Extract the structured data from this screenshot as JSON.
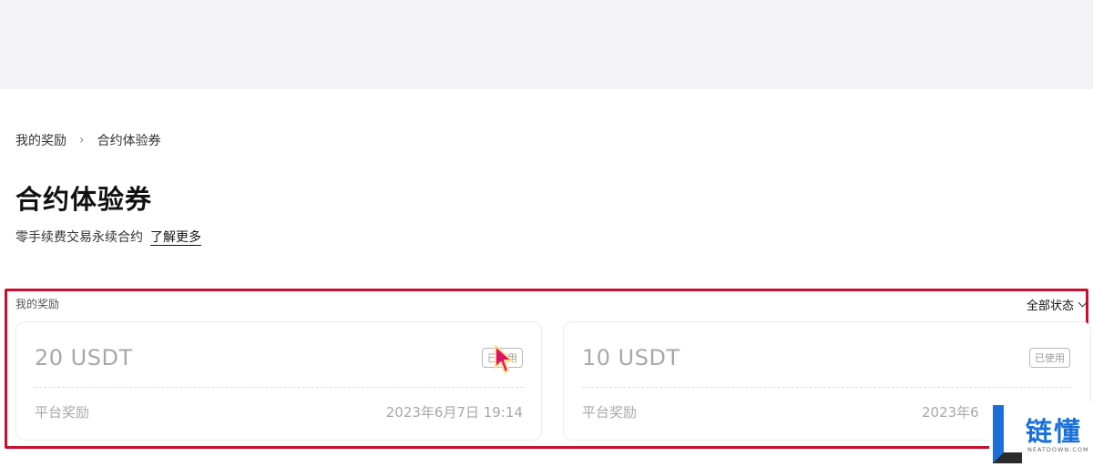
{
  "breadcrumb": {
    "parent": "我的奖励",
    "current": "合约体验券"
  },
  "page": {
    "title": "合约体验券",
    "subtitle": "零手续费交易永续合约",
    "learn_more": "了解更多"
  },
  "rewards": {
    "section_label": "我的奖励",
    "filter_label": "全部状态",
    "cards": [
      {
        "amount": "20 USDT",
        "status": "已使用",
        "source": "平台奖励",
        "date": "2023年6月7日 19:14"
      },
      {
        "amount": "10 USDT",
        "status": "已使用",
        "source": "平台奖励",
        "date": "2023年6"
      }
    ]
  },
  "watermark": {
    "cn": "链懂",
    "en": "NEATDOWN.COM"
  },
  "colors": {
    "highlight": "#c8102e",
    "cursor": "#e0106a",
    "brand_blue": "#1b70d8"
  }
}
